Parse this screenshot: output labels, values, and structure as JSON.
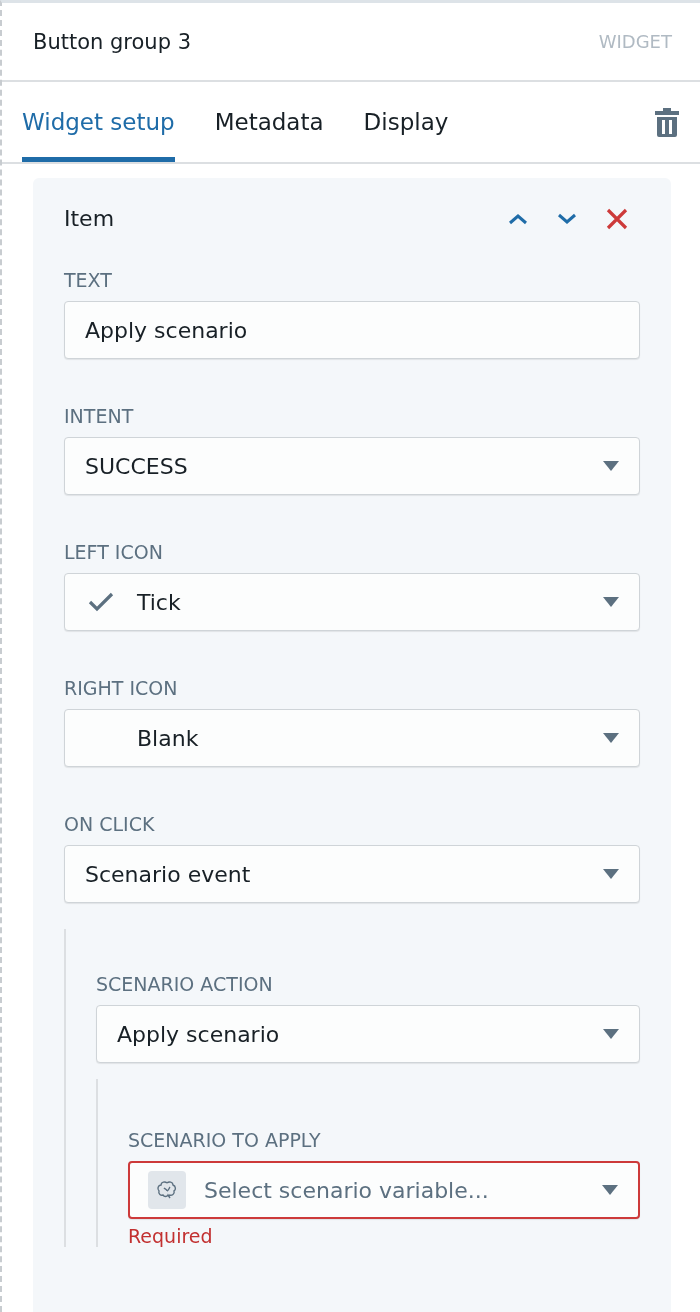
{
  "header": {
    "title": "Button group 3",
    "tag": "WIDGET"
  },
  "tabs": [
    {
      "label": "Widget setup",
      "selected": true
    },
    {
      "label": "Metadata",
      "selected": false
    },
    {
      "label": "Display",
      "selected": false
    }
  ],
  "item": {
    "title": "Item"
  },
  "fields": [
    {
      "label": "TEXT",
      "kind": "text",
      "value": "Apply scenario"
    },
    {
      "label": "INTENT",
      "kind": "select",
      "value": "SUCCESS"
    },
    {
      "label": "LEFT ICON",
      "kind": "ticked",
      "value": "Tick"
    },
    {
      "label": "RIGHT ICON",
      "kind": "iconless",
      "value": "Blank"
    },
    {
      "label": "ON CLICK",
      "kind": "select",
      "value": "Scenario event"
    }
  ],
  "scenario": {
    "fields": [
      {
        "label": "SCENARIO ACTION",
        "kind": "select",
        "value": "Apply scenario"
      }
    ],
    "child": {
      "fields": [
        {
          "label": "SCENARIO TO APPLY",
          "kind": "variable",
          "placeholder": "Select scenario variable...",
          "invalid": true,
          "error": "Required"
        }
      ]
    }
  }
}
